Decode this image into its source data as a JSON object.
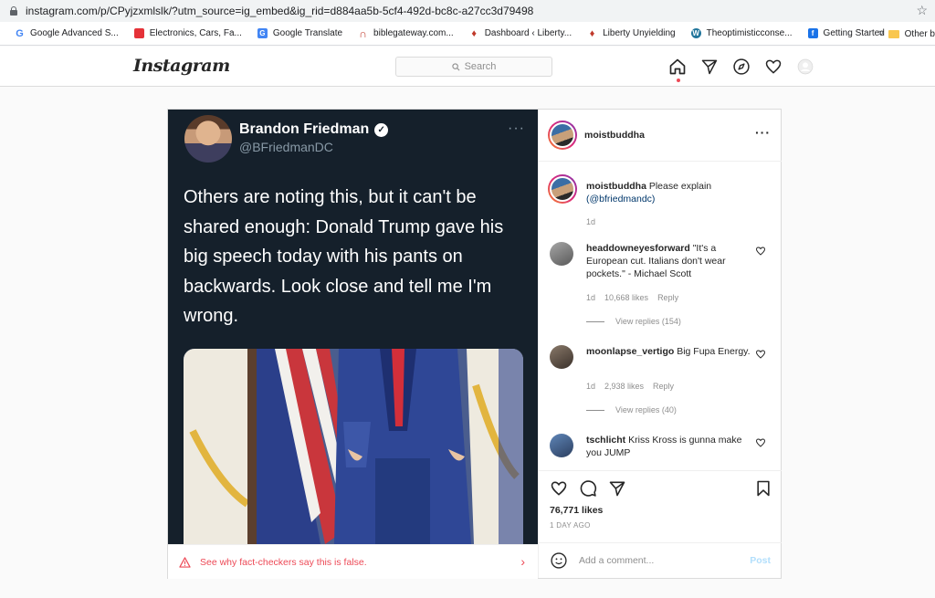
{
  "browser": {
    "url": "instagram.com/p/CPyjzxmlslk/?utm_source=ig_embed&ig_rid=d884aa5b-5cf4-492d-bc8c-a27cc3d79498",
    "bookmarks": [
      {
        "label": "Google Advanced S...",
        "icon": "google-icon",
        "color": "#4285f4"
      },
      {
        "label": "Electronics, Cars, Fa...",
        "icon": "shopping-bag-icon",
        "color": "#e53238"
      },
      {
        "label": "Google Translate",
        "icon": "translate-icon",
        "color": "#4285f4"
      },
      {
        "label": "biblegateway.com...",
        "icon": "biblegateway-icon",
        "color": "#c0392b"
      },
      {
        "label": "Dashboard ‹ Liberty...",
        "icon": "flame-icon",
        "color": "#c0392b"
      },
      {
        "label": "Liberty Unyielding",
        "icon": "flame-icon",
        "color": "#c0392b"
      },
      {
        "label": "Theoptimisticconse...",
        "icon": "wordpress-icon",
        "color": "#21759b"
      },
      {
        "label": "Getting Started",
        "icon": "firefox-icon",
        "color": "#1a73e8"
      }
    ],
    "more": "»",
    "other_bookmarks": "Other b"
  },
  "ig": {
    "logo": "Instagram",
    "search_placeholder": "Search"
  },
  "tweet": {
    "name": "Brandon Friedman",
    "handle": "@BFriedmanDC",
    "more": "···",
    "text": "Others are noting this, but it can't be shared enough: Donald Trump gave his big speech today with his pants on backwards. Look close and tell me I'm wrong."
  },
  "fact_check": {
    "label": "See why fact-checkers say this is false."
  },
  "post": {
    "author": "moistbuddha",
    "caption_author": "moistbuddha",
    "caption_text": "Please explain",
    "caption_mention": "(@bfriedmandc)",
    "caption_age": "1d",
    "comments": [
      {
        "user": "headdowneyesforward",
        "text": "\"It's a European cut. Italians don't wear pockets.\" - Michael Scott",
        "age": "1d",
        "likes": "10,668 likes",
        "reply": "Reply",
        "view_replies": "View replies (154)"
      },
      {
        "user": "moonlapse_vertigo",
        "text": "Big Fupa Energy.",
        "age": "1d",
        "likes": "2,938 likes",
        "reply": "Reply",
        "view_replies": "View replies (40)"
      },
      {
        "user": "tschlicht",
        "text": "Kriss Kross is gunna make you JUMP"
      }
    ],
    "likes": "76,771 likes",
    "age": "1 DAY AGO",
    "comment_placeholder": "Add a comment...",
    "post_label": "Post"
  }
}
